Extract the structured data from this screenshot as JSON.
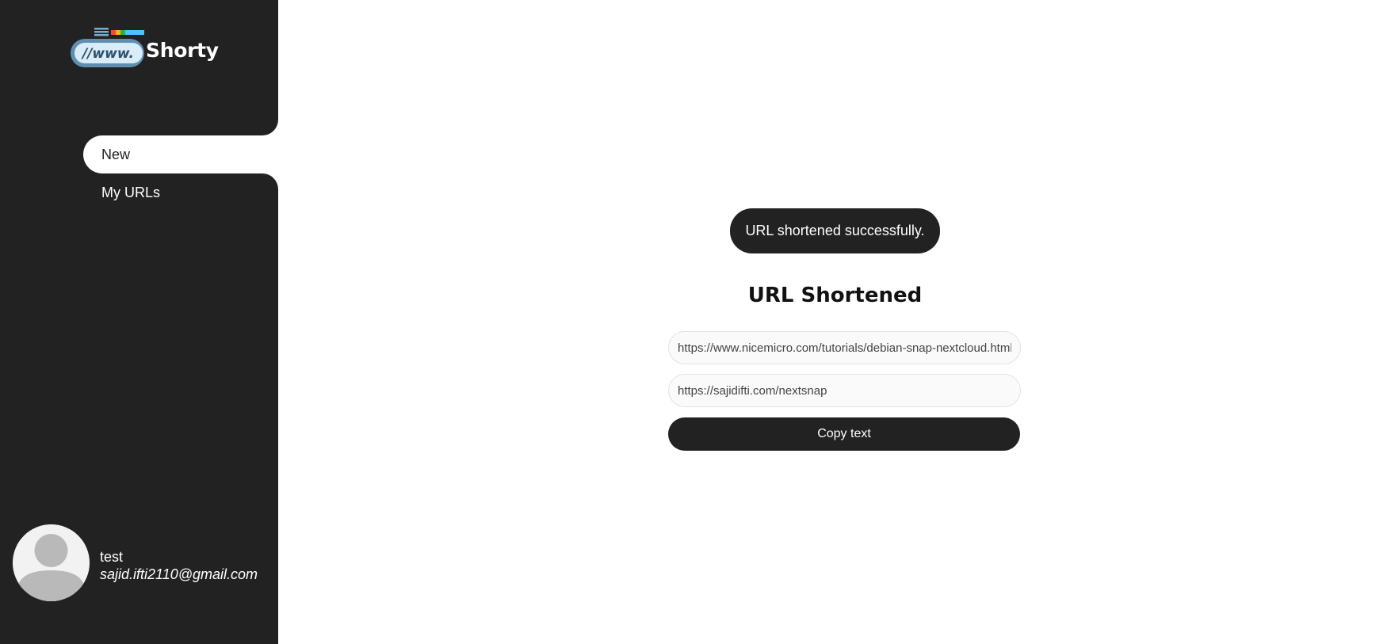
{
  "brand": {
    "name": "Shorty",
    "logo_text": "//www."
  },
  "sidebar": {
    "items": [
      {
        "label": "New",
        "active": true
      },
      {
        "label": "My URLs",
        "active": false
      }
    ]
  },
  "user": {
    "name": "test",
    "email": "sajid.ifti2110@gmail.com"
  },
  "main": {
    "toast": "URL shortened successfully.",
    "title": "URL Shortened",
    "long_url": "https://www.nicemicro.com/tutorials/debian-snap-nextcloud.html",
    "short_url": "https://sajidifti.com/nextsnap",
    "copy_label": "Copy text"
  },
  "colors": {
    "sidebar_bg": "#222222",
    "accent": "#222222",
    "field_bg": "#fafafa"
  }
}
